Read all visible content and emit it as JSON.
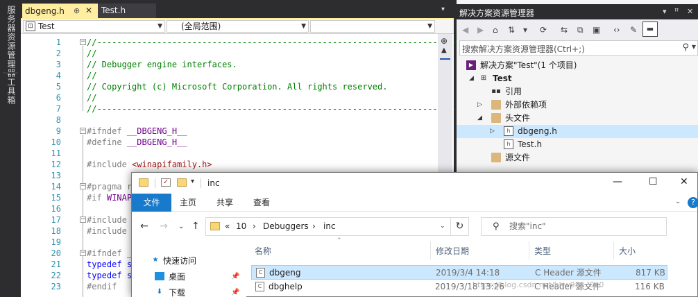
{
  "vs": {
    "side_tabs": [
      "服务器资源管理器",
      "工具箱"
    ],
    "tabs": [
      {
        "name": "dbgeng.h",
        "pin": "⊕",
        "close": "✕"
      },
      {
        "name": "Test.h"
      }
    ],
    "nav": {
      "project": "Test",
      "scope": "(全局范围)",
      "member": ""
    },
    "line_numbers": [
      "1",
      "2",
      "3",
      "4",
      "5",
      "6",
      "7",
      "8",
      "9",
      "10",
      "11",
      "12",
      "13",
      "14",
      "15",
      "16",
      "17",
      "18",
      "19",
      "20",
      "21",
      "22",
      "23"
    ],
    "code": {
      "l1": "//----------------------------------------------------------------------------",
      "l2": "//",
      "l3": "// Debugger engine interfaces.",
      "l4": "//",
      "l5": "// Copyright (c) Microsoft Corporation. All rights reserved.",
      "l6": "//",
      "l7": "//----------------------------------------------------------------------------",
      "l9_kw": "#ifndef",
      "l9_mac": "__DBGENG_H__",
      "l10_kw": "#define",
      "l10_mac": "__DBGENG_H__",
      "l12_kw": "#include",
      "l12_str": "<winapifamily.h>",
      "l14_kw": "#pragma",
      "l14_rest": "r",
      "l15_kw": "#if",
      "l15_rest": "WINAP",
      "l17_kw": "#include",
      "l18_kw": "#include",
      "l20_kw": "#ifndef",
      "l20_rest": "_",
      "l21_kw": "typedef",
      "l21_rest": "s",
      "l22_kw": "typedef",
      "l22_rest": "s",
      "l23_kw": "#endif"
    }
  },
  "solution_explorer": {
    "title": "解决方案资源管理器",
    "title_buttons": [
      "▾",
      "ꟸ",
      "✕"
    ],
    "search_placeholder": "搜索解决方案资源管理器(Ctrl+;)",
    "tree": [
      {
        "label": "解决方案\"Test\"(1 个项目)",
        "icon": "solution-icon"
      },
      {
        "label": "Test",
        "icon": "project-icon"
      },
      {
        "label": "引用",
        "icon": "references-icon"
      },
      {
        "label": "外部依赖项",
        "icon": "external-deps-icon"
      },
      {
        "label": "头文件",
        "icon": "folder-icon"
      },
      {
        "label": "dbgeng.h",
        "icon": "header-file-icon"
      },
      {
        "label": "Test.h",
        "icon": "header-file-icon"
      },
      {
        "label": "源文件",
        "icon": "folder-icon"
      }
    ]
  },
  "explorer": {
    "title": "inc",
    "ribbon_tabs": [
      "文件",
      "主页",
      "共享",
      "查看"
    ],
    "breadcrumb": [
      "«",
      "10",
      "›",
      "Debuggers",
      "›",
      "inc"
    ],
    "search_placeholder": "搜索\"inc\"",
    "nav_pane": [
      {
        "label": "快速访问",
        "icon": "star-icon"
      },
      {
        "label": "桌面",
        "icon": "desktop-icon"
      },
      {
        "label": "下载",
        "icon": "download-icon"
      }
    ],
    "columns": [
      "名称",
      "修改日期",
      "类型",
      "大小"
    ],
    "files": [
      {
        "name": "dbgeng",
        "date": "2019/3/4 14:18",
        "type": "C Header 源文件",
        "size": "817 KB"
      },
      {
        "name": "dbghelp",
        "date": "2019/3/18 13:26",
        "type": "C Header 源文件",
        "size": "116 KB"
      }
    ],
    "watermark": "https://blog.csdn.net/bhw98/...0x0"
  },
  "colors": {
    "vs_dark": "#2d2d30",
    "tab_active": "#ffeea0",
    "comment": "#008000",
    "preprocessor": "#808080",
    "macro": "#6f008a",
    "string": "#a31515",
    "ribbon_file": "#1979ca",
    "selection": "#cce8ff"
  }
}
